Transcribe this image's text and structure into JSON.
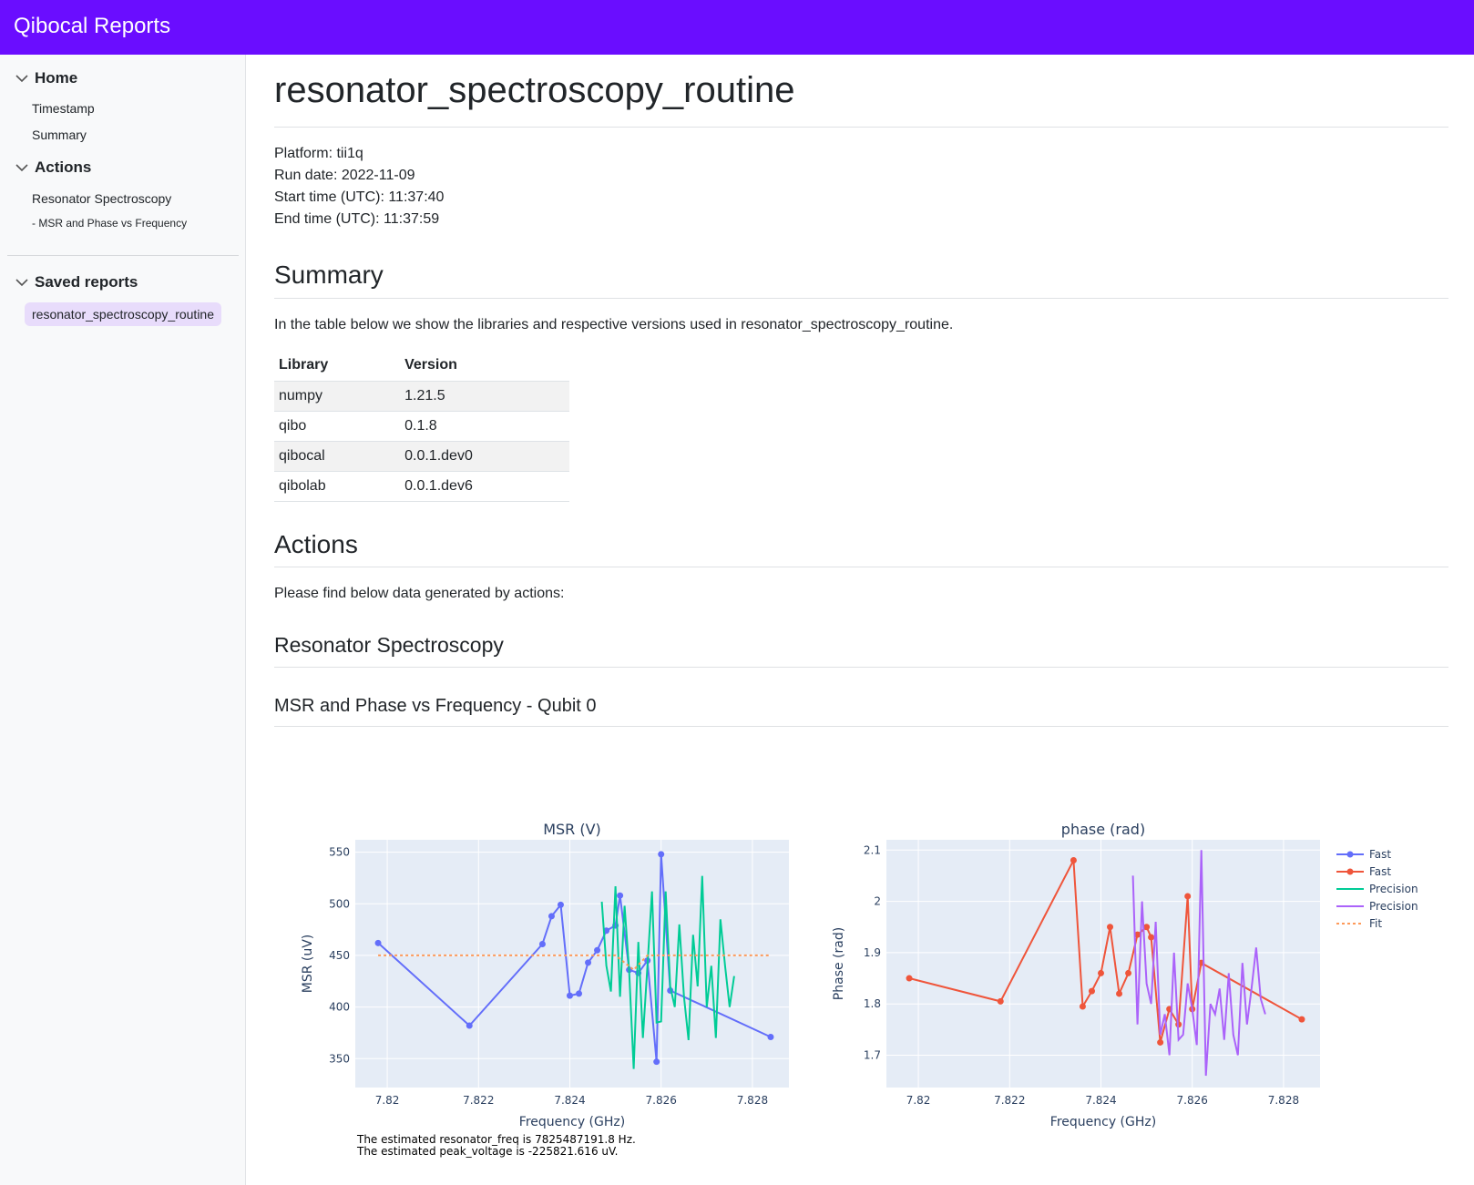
{
  "header": {
    "brand": "Qibocal Reports"
  },
  "sidebar": {
    "home": {
      "label": "Home",
      "items": [
        {
          "label": "Timestamp"
        },
        {
          "label": "Summary"
        }
      ]
    },
    "actions": {
      "label": "Actions",
      "items": [
        {
          "label": "Resonator Spectroscopy"
        },
        {
          "label": "- MSR and Phase vs Frequency"
        }
      ]
    },
    "saved": {
      "label": "Saved reports",
      "items": [
        {
          "label": "resonator_spectroscopy_routine"
        }
      ]
    }
  },
  "main": {
    "title": "resonator_spectroscopy_routine",
    "meta": [
      "Platform: tii1q",
      "Run date: 2022-11-09",
      "Start time (UTC): 11:37:40",
      "End time (UTC): 11:37:59"
    ],
    "summary": {
      "heading": "Summary",
      "text": "In the table below we show the libraries and respective versions used in resonator_spectroscopy_routine.",
      "table": {
        "headers": [
          "Library",
          "Version"
        ],
        "rows": [
          [
            "numpy",
            "1.21.5"
          ],
          [
            "qibo",
            "0.1.8"
          ],
          [
            "qibocal",
            "0.0.1.dev0"
          ],
          [
            "qibolab",
            "0.0.1.dev6"
          ]
        ]
      }
    },
    "actions": {
      "heading": "Actions",
      "text": "Please find below data generated by actions:",
      "subheading": "Resonator Spectroscopy",
      "plot_title": "MSR and Phase vs Frequency - Qubit 0"
    },
    "notes": [
      "The estimated resonator_freq is 7825487191.8 Hz.",
      "The estimated peak_voltage is -225821.616 uV."
    ]
  },
  "chart_data": [
    {
      "type": "line",
      "title": "MSR (V)",
      "xlabel": "Frequency (GHz)",
      "ylabel": "MSR (uV)",
      "xlim": [
        7.8193,
        7.8288
      ],
      "ylim": [
        322,
        562
      ],
      "xticks": [
        7.82,
        7.822,
        7.824,
        7.826,
        7.828
      ],
      "xtick_labels": [
        "7.82",
        "7.822",
        "7.824",
        "7.826",
        "7.828"
      ],
      "yticks": [
        350,
        400,
        450,
        500,
        550
      ],
      "grid": true,
      "series": [
        {
          "name": "Fast",
          "color": "#636efa",
          "mode": "lines+markers",
          "x": [
            7.8198,
            7.8218,
            7.8234,
            7.8236,
            7.8238,
            7.824,
            7.8242,
            7.8244,
            7.8246,
            7.8248,
            7.825,
            7.8251,
            7.8253,
            7.8255,
            7.8257,
            7.8259,
            7.826,
            7.8262,
            7.8284
          ],
          "y": [
            462,
            382,
            461,
            488,
            499,
            411,
            413,
            443,
            455,
            474,
            479,
            508,
            436,
            433,
            445,
            347,
            548,
            416,
            371
          ]
        },
        {
          "name": "Precision",
          "color": "#00cc96",
          "mode": "lines",
          "x": [
            7.8247,
            7.8248,
            7.8249,
            7.825,
            7.8251,
            7.8252,
            7.8253,
            7.8254,
            7.8255,
            7.8256,
            7.8257,
            7.8258,
            7.8259,
            7.826,
            7.8261,
            7.8262,
            7.8263,
            7.8264,
            7.8265,
            7.8266,
            7.8267,
            7.8268,
            7.8269,
            7.827,
            7.8271,
            7.8272,
            7.8273,
            7.8274,
            7.8275,
            7.8276
          ],
          "y": [
            502,
            440,
            415,
            517,
            410,
            498,
            435,
            340,
            463,
            370,
            440,
            512,
            385,
            386,
            512,
            420,
            400,
            480,
            410,
            368,
            470,
            420,
            527,
            400,
            440,
            370,
            485,
            440,
            400,
            430
          ]
        },
        {
          "name": "Fit",
          "color": "#fe9a5a",
          "mode": "dashed",
          "x": [
            7.8198,
            7.825,
            7.8254,
            7.8257,
            7.8284
          ],
          "y": [
            450,
            450,
            436,
            450,
            450
          ]
        }
      ]
    },
    {
      "type": "line",
      "title": "phase (rad)",
      "xlabel": "Frequency (GHz)",
      "ylabel": "Phase (rad)",
      "xlim": [
        7.8193,
        7.8288
      ],
      "ylim": [
        1.637,
        2.12
      ],
      "xticks": [
        7.82,
        7.822,
        7.824,
        7.826,
        7.828
      ],
      "xtick_labels": [
        "7.82",
        "7.822",
        "7.824",
        "7.826",
        "7.828"
      ],
      "yticks": [
        1.7,
        1.8,
        1.9,
        2.0,
        2.1
      ],
      "ytick_labels": [
        "1.7",
        "1.8",
        "1.9",
        "2",
        "2.1"
      ],
      "grid": true,
      "series": [
        {
          "name": "Fast",
          "color": "#ef553b",
          "mode": "lines+markers",
          "x": [
            7.8198,
            7.8218,
            7.8234,
            7.8236,
            7.8238,
            7.824,
            7.8242,
            7.8244,
            7.8246,
            7.8248,
            7.825,
            7.8251,
            7.8253,
            7.8255,
            7.8257,
            7.8259,
            7.826,
            7.8262,
            7.8284
          ],
          "y": [
            1.85,
            1.805,
            2.08,
            1.795,
            1.825,
            1.86,
            1.95,
            1.82,
            1.86,
            1.935,
            1.95,
            1.93,
            1.725,
            1.79,
            1.76,
            2.01,
            1.79,
            1.88,
            1.77
          ]
        },
        {
          "name": "Precision",
          "color": "#ab63fa",
          "mode": "lines",
          "x": [
            7.8247,
            7.8248,
            7.8249,
            7.825,
            7.8251,
            7.8252,
            7.8253,
            7.8254,
            7.8255,
            7.8256,
            7.8257,
            7.8258,
            7.8259,
            7.826,
            7.8261,
            7.8262,
            7.8263,
            7.8264,
            7.8265,
            7.8266,
            7.8267,
            7.8268,
            7.8269,
            7.827,
            7.8271,
            7.8272,
            7.8273,
            7.8274,
            7.8275,
            7.8276
          ],
          "y": [
            2.05,
            1.76,
            2.0,
            1.84,
            1.8,
            1.96,
            1.74,
            1.78,
            1.7,
            1.9,
            1.73,
            1.74,
            1.84,
            1.79,
            1.72,
            2.1,
            1.66,
            1.8,
            1.78,
            1.83,
            1.73,
            1.86,
            1.74,
            1.7,
            1.88,
            1.76,
            1.83,
            1.91,
            1.81,
            1.78
          ]
        }
      ]
    }
  ],
  "legend": {
    "position": "right",
    "items": [
      {
        "label": "Fast",
        "color": "#636efa",
        "style": "line-marker"
      },
      {
        "label": "Fast",
        "color": "#ef553b",
        "style": "line-marker"
      },
      {
        "label": "Precision",
        "color": "#00cc96",
        "style": "line"
      },
      {
        "label": "Precision",
        "color": "#ab63fa",
        "style": "line"
      },
      {
        "label": "Fit",
        "color": "#fe9a5a",
        "style": "dash"
      }
    ]
  },
  "colors": {
    "header": "#6a0dff",
    "plot_bg": "#e5ecf6",
    "saved_highlight": "#e8dcfb"
  }
}
